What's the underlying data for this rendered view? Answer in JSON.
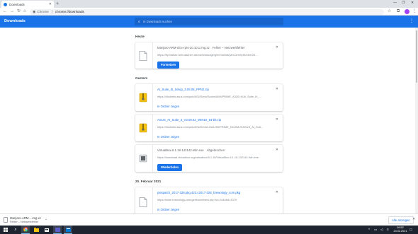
{
  "browser": {
    "tab_title": "Downloads",
    "site_label": "Chrome",
    "url": "chrome://downloads"
  },
  "page": {
    "title": "Downloads",
    "search_placeholder": "In Downloads suchen"
  },
  "sections": [
    {
      "heading": "Heute",
      "items": [
        {
          "filename": "Manjaro-ARM-xfce-rpi4-20.10.1.img.xz",
          "status": "Fehler – Netzwerkfehler",
          "url": "https://ftp.halifax.rwth-aachen.de/osdn/storage/g/m/ma/manjaro-arm/rpi4/xfce/20....",
          "action": "Fortsetzen"
        }
      ]
    },
    {
      "heading": "Gestern",
      "items": [
        {
          "filename": "AI_Suite_III_Setup_3.05.05_PPN2.zip",
          "url": "https://dlcdnets.asus.com/pub/ASUS/mb/SocketAM4/PRIME_A320I-K/AI_Suite_III_...",
          "action": "In Ordner zeigen"
        },
        {
          "filename": "ASUS_AI_Suite_3_V3.00.62_WIN10_64-bit.zip",
          "url": "https://dlcdnets.asus.com/pub/ASUS/mb/LGA1200/PRIME_H410M-R/ASUS_AI_Suit...",
          "action": "In Ordner zeigen"
        },
        {
          "filename": "VirtualBox-6.1.18-142142-Win.exe",
          "status": "Abgebrochen",
          "url": "https://download.virtualbox.org/virtualbox/6.1.18/VirtualBox-6.1.18-142142-Win.exe",
          "action": "Wiederholen"
        }
      ]
    },
    {
      "heading": "20. Februar 2021",
      "items": [
        {
          "filename": "psispatch_2017-328.pkg.423.c2017-328_brewology_com.pkg",
          "url": "https://store.brewology.com/get/homebrew.php?id=244&fid=3079",
          "action": "In Ordner zeigen"
        }
      ]
    }
  ],
  "shelf": {
    "filename": "Manjaro-ARM-...img.xz",
    "status": "Fehler – Netzwerkfehler",
    "show_all": "Alle anzeigen"
  },
  "taskbar": {
    "time": "09:52",
    "date": "24.02.2021"
  },
  "colors": {
    "accent": "#1a73e8",
    "taskbar": "#1f2530"
  }
}
